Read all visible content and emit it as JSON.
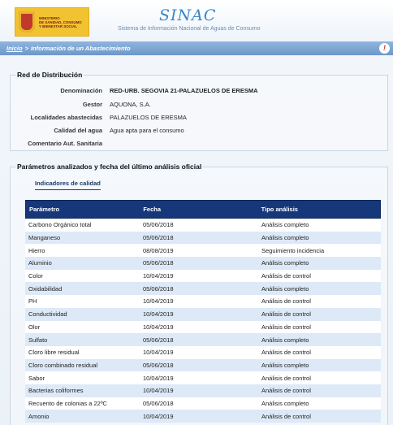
{
  "header": {
    "ministry": "MINISTERIO\nDE SANIDAD, CONSUMO\nY BIENESTAR SOCIAL",
    "brand": "SINAC",
    "subtitle": "Sistema de Información Nacional de Aguas de Consumo"
  },
  "nav": {
    "home": "Inicio",
    "separator": ">",
    "current": "Información de un Abastecimiento",
    "info_icon": "!"
  },
  "distribution": {
    "title": "Red de Distribución",
    "fields": [
      {
        "label": "Denominación",
        "value": "RED-URB. SEGOVIA 21-PALAZUELOS DE ERESMA"
      },
      {
        "label": "Gestor",
        "value": "AQUONA, S.A."
      },
      {
        "label": "Localidades abastecidas",
        "value": "PALAZUELOS DE ERESMA"
      },
      {
        "label": "Calidad del agua",
        "value": "Agua apta para el consumo"
      },
      {
        "label": "Comentario Aut. Sanitaria",
        "value": ""
      }
    ]
  },
  "parameters": {
    "title": "Parámetros analizados y fecha del último análisis oficial",
    "tab": "Indicadores de calidad",
    "columns": [
      "Parámetro",
      "Fecha",
      "Tipo análisis"
    ],
    "rows": [
      [
        "Carbono Orgánico total",
        "05/06/2018",
        "Análisis completo"
      ],
      [
        "Manganeso",
        "05/06/2018",
        "Análisis completo"
      ],
      [
        "Hierro",
        "08/08/2019",
        "Seguimiento incidencia"
      ],
      [
        "Aluminio",
        "05/06/2018",
        "Análisis completo"
      ],
      [
        "Color",
        "10/04/2019",
        "Análisis de control"
      ],
      [
        "Oxidabilidad",
        "05/06/2018",
        "Análisis completo"
      ],
      [
        "PH",
        "10/04/2019",
        "Análisis de control"
      ],
      [
        "Conductividad",
        "10/04/2019",
        "Análisis de control"
      ],
      [
        "Olor",
        "10/04/2019",
        "Análisis de control"
      ],
      [
        "Sulfato",
        "05/06/2018",
        "Análisis completo"
      ],
      [
        "Cloro libre residual",
        "10/04/2019",
        "Análisis de control"
      ],
      [
        "Cloro combinado residual",
        "05/06/2018",
        "Análisis completo"
      ],
      [
        "Sabor",
        "10/04/2019",
        "Análisis de control"
      ],
      [
        "Bacterias coliformes",
        "10/04/2019",
        "Análisis de control"
      ],
      [
        "Recuento de colonias a 22ºC",
        "05/06/2018",
        "Análisis completo"
      ],
      [
        "Amonio",
        "10/04/2019",
        "Análisis de control"
      ]
    ]
  },
  "colors": {
    "header_blue": "#16377a",
    "nav_blue": "#7ea7d6",
    "row_alt": "#dde9f7"
  }
}
